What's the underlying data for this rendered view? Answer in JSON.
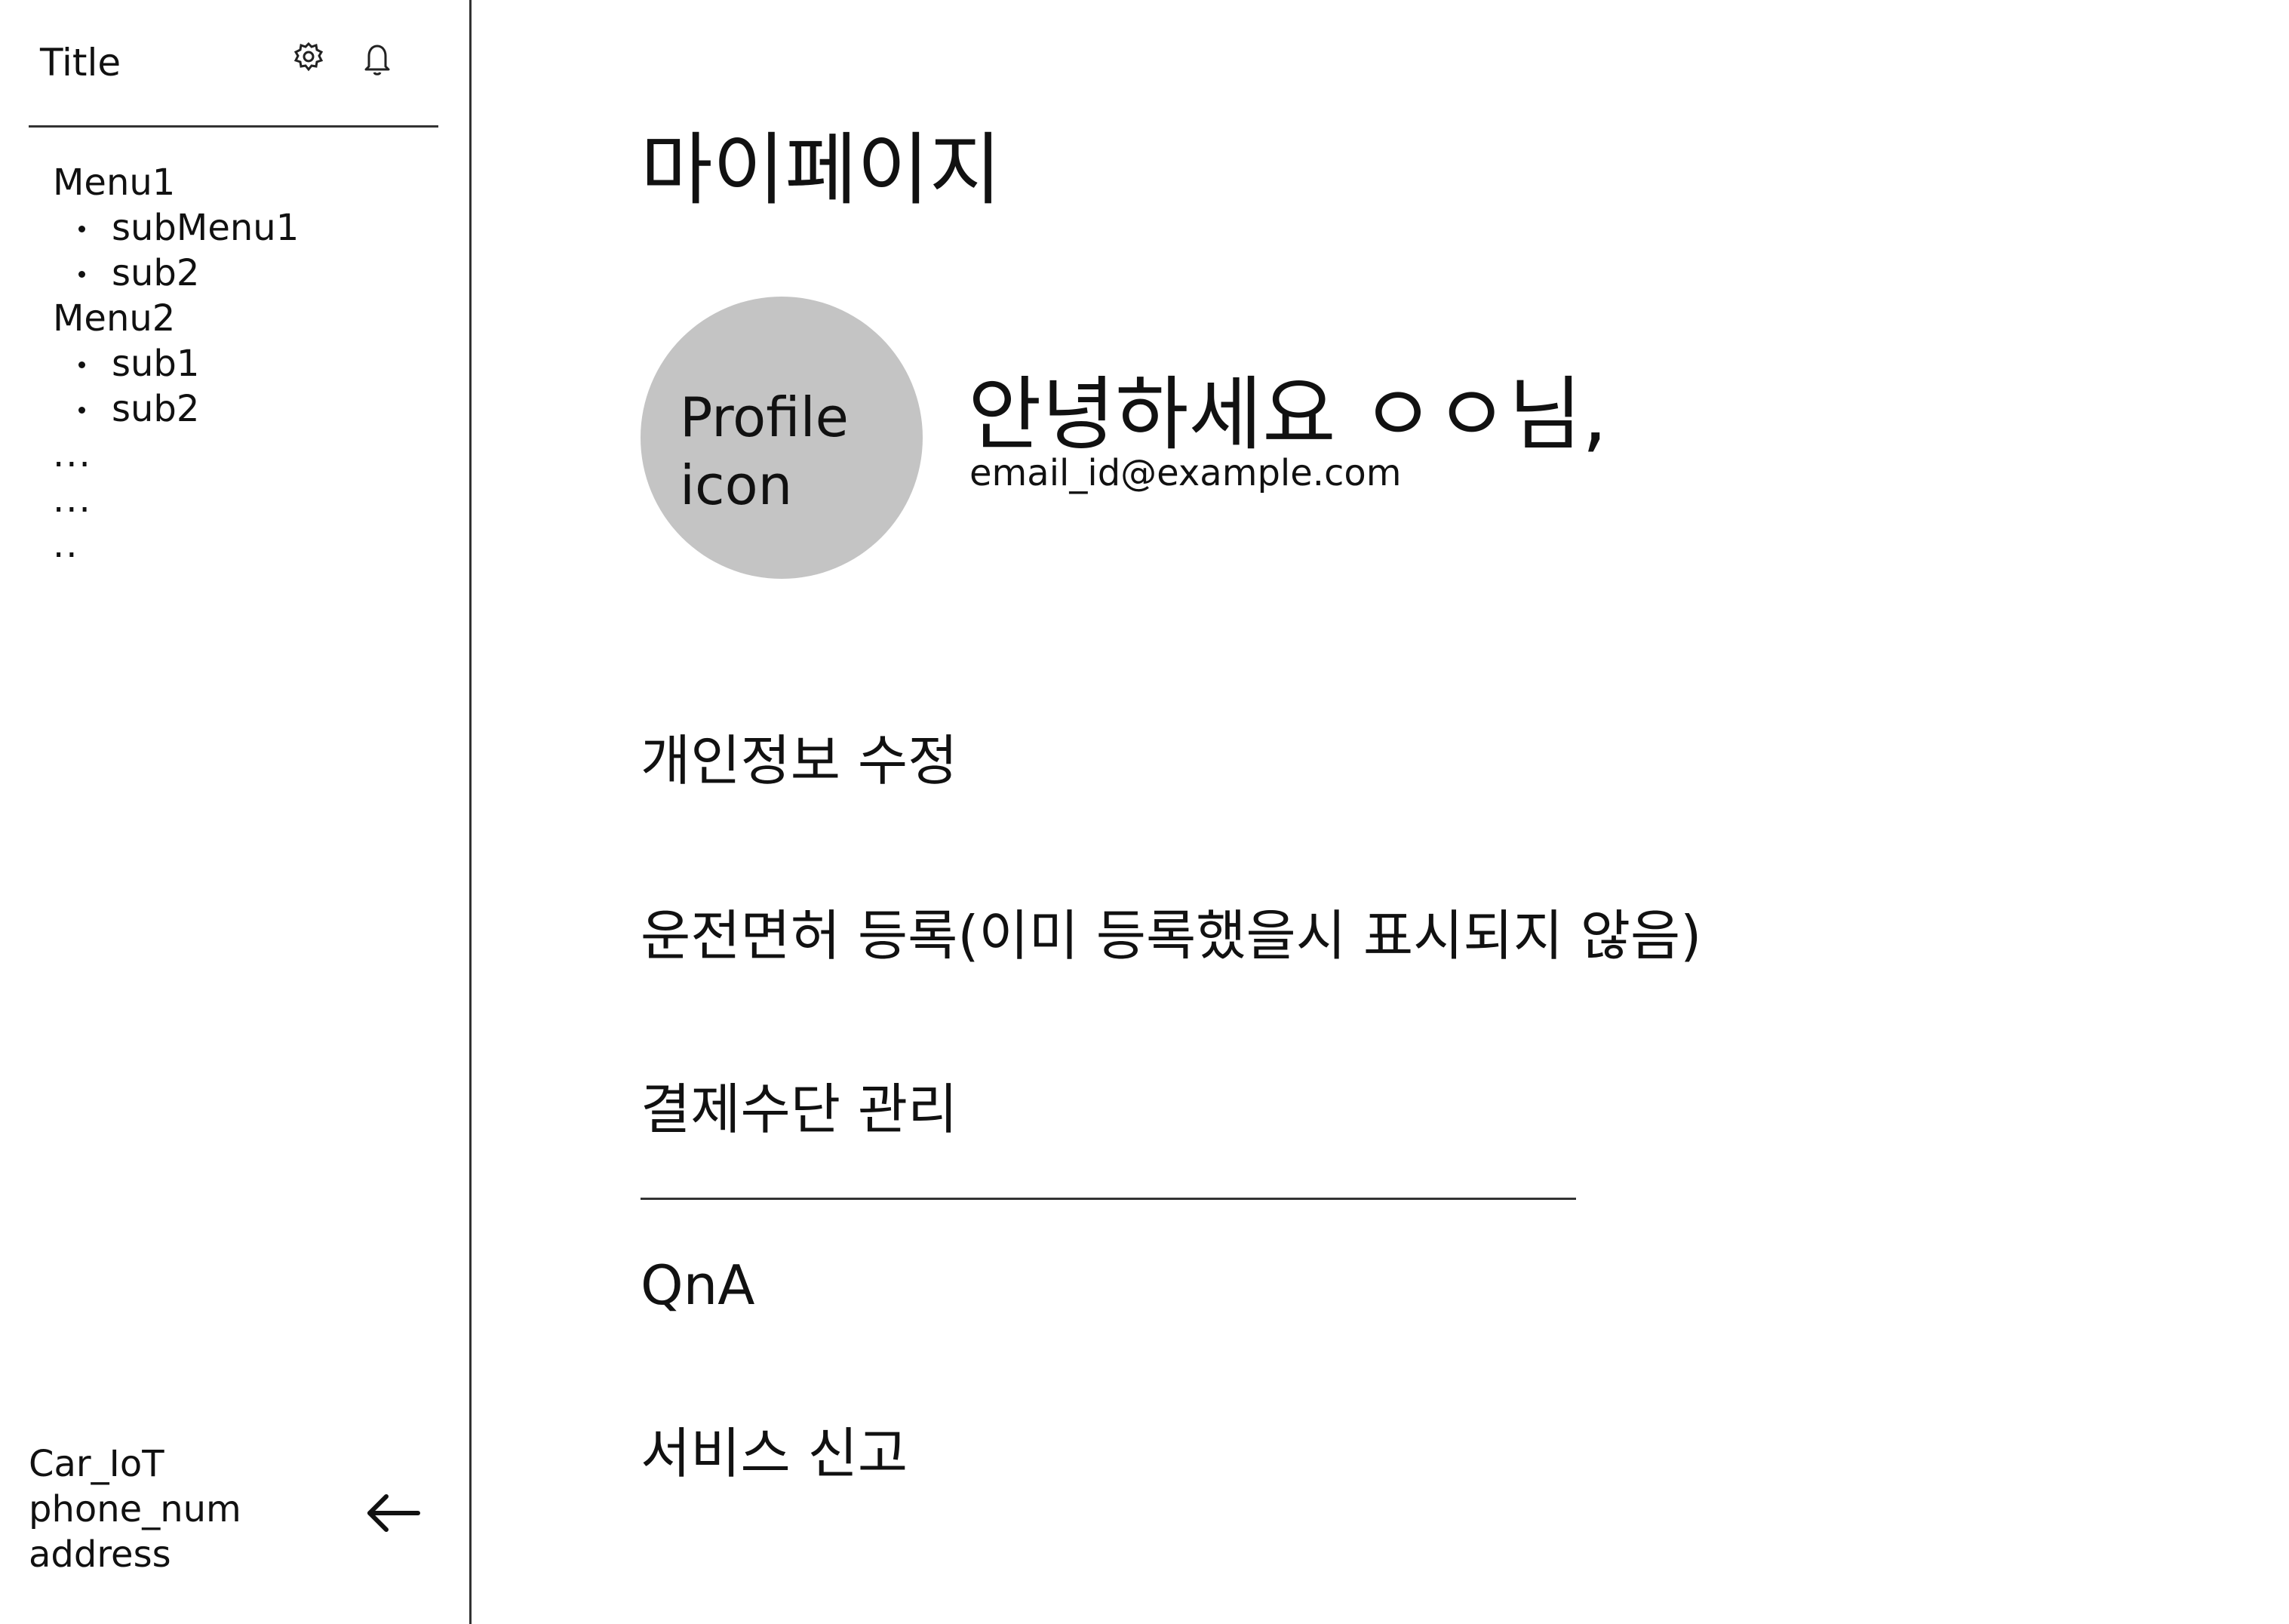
{
  "sidebar": {
    "title": "Title",
    "icons": [
      "gear-icon",
      "bell-icon"
    ],
    "menu": [
      {
        "label": "Menu1",
        "subs": [
          "subMenu1",
          "sub2"
        ]
      },
      {
        "label": "Menu2",
        "subs": [
          "sub1",
          "sub2"
        ]
      }
    ],
    "ellipses": [
      "...",
      "...",
      ".."
    ],
    "footer": {
      "line1": "Car_IoT",
      "line2": "phone_num",
      "line3": "address"
    },
    "back_icon": "arrow-left-icon"
  },
  "main": {
    "page_title": "마이페이지",
    "profile": {
      "avatar_text_1": "Profile",
      "avatar_text_2": "icon",
      "greeting": "안녕하세요 ㅇㅇ님,",
      "email": "email_id@example.com"
    },
    "items": {
      "edit_info": "개인정보 수정",
      "license": "운전면허 등록(이미 등록했을시 표시되지 않음)",
      "payment": "결제수단 관리",
      "qna": "QnA",
      "report": "서비스 신고"
    }
  }
}
